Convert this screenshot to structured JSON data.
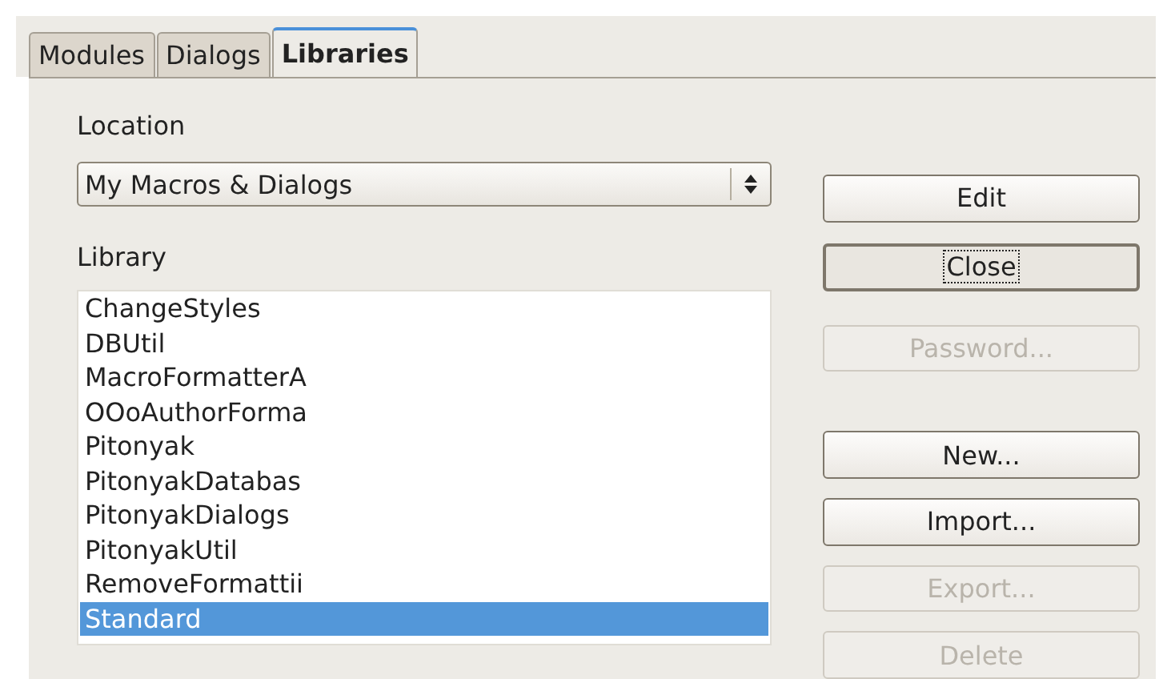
{
  "tabs": [
    {
      "label": "Modules",
      "selected": false
    },
    {
      "label": "Dialogs",
      "selected": false
    },
    {
      "label": "Libraries",
      "selected": true
    }
  ],
  "location": {
    "label": "Location",
    "value": "My Macros & Dialogs"
  },
  "library": {
    "label": "Library",
    "items": [
      {
        "name": "ChangeStyles",
        "selected": false
      },
      {
        "name": "DBUtil",
        "selected": false
      },
      {
        "name": "MacroFormatterA",
        "selected": false
      },
      {
        "name": "OOoAuthorForma",
        "selected": false
      },
      {
        "name": "Pitonyak",
        "selected": false
      },
      {
        "name": "PitonyakDatabas",
        "selected": false
      },
      {
        "name": "PitonyakDialogs",
        "selected": false
      },
      {
        "name": "PitonyakUtil",
        "selected": false
      },
      {
        "name": "RemoveFormattii",
        "selected": false
      },
      {
        "name": "Standard",
        "selected": true
      }
    ]
  },
  "buttons": [
    {
      "label": "Edit",
      "disabled": false,
      "focused": false
    },
    {
      "label": "Close",
      "disabled": false,
      "focused": true
    },
    {
      "label": "Password...",
      "disabled": true,
      "focused": false
    },
    {
      "label": "New...",
      "disabled": false,
      "focused": false
    },
    {
      "label": "Import...",
      "disabled": false,
      "focused": false
    },
    {
      "label": "Export...",
      "disabled": true,
      "focused": false
    },
    {
      "label": "Delete",
      "disabled": true,
      "focused": false
    }
  ]
}
